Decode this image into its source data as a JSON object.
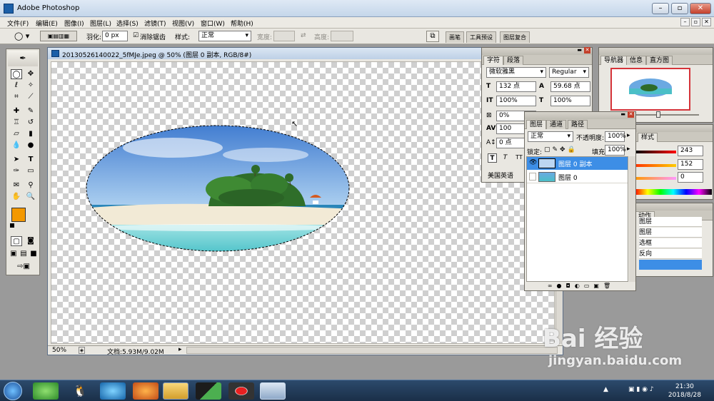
{
  "app": {
    "title": "Adobe Photoshop"
  },
  "menu": [
    "文件(F)",
    "编辑(E)",
    "图像(I)",
    "图层(L)",
    "选择(S)",
    "滤镜(T)",
    "视图(V)",
    "窗口(W)",
    "帮助(H)"
  ],
  "options": {
    "feather_label": "羽化:",
    "feather_value": "0 px",
    "antialias_label": "消除锯齿",
    "style_label": "样式:",
    "style_value": "正常",
    "width_label": "宽度:",
    "height_label": "高度:",
    "palette_tabs": [
      "画笔",
      "工具预设",
      "图层复合"
    ]
  },
  "document": {
    "title": "20130526140022_5fMJe.jpeg @ 50% (图层 0 副本, RGB/8#)",
    "zoom": "50%",
    "doc_info": "文档:5.93M/9.02M"
  },
  "character": {
    "tabs": [
      "字符",
      "段落"
    ],
    "font_family": "微软雅黑",
    "font_style": "Regular",
    "size": "132 点",
    "leading": "59.68 点",
    "vscale": "100%",
    "hscale": "100%",
    "tracking_pct": "0%",
    "kerning": "100",
    "baseline": "0 点",
    "language": "美国英语",
    "style_buttons": [
      "T",
      "T",
      "TT"
    ]
  },
  "layers": {
    "tabs": [
      "图层",
      "通道",
      "路径"
    ],
    "blend_mode": "正常",
    "opacity_label": "不透明度:",
    "opacity_value": "100%",
    "lock_label": "锁定:",
    "fill_label": "填充:",
    "fill_value": "100%",
    "items": [
      {
        "name": "图层 0 副本",
        "selected": true,
        "visible": true
      },
      {
        "name": "图层 0",
        "selected": false,
        "visible": false
      }
    ]
  },
  "navigator": {
    "tabs": [
      "导航器",
      "信息",
      "直方图"
    ]
  },
  "color": {
    "tab": "样式",
    "values": [
      "243",
      "152",
      "0"
    ],
    "fg_color": "#f39800"
  },
  "actions": {
    "tab": "动作",
    "items": [
      "图层",
      "图层",
      "选框",
      "反向",
      ""
    ]
  },
  "taskbar": {
    "time": "21:30",
    "date": "2018/8/28"
  },
  "watermark": {
    "brand": "Bai 经验",
    "url": "jingyan.baidu.com"
  }
}
